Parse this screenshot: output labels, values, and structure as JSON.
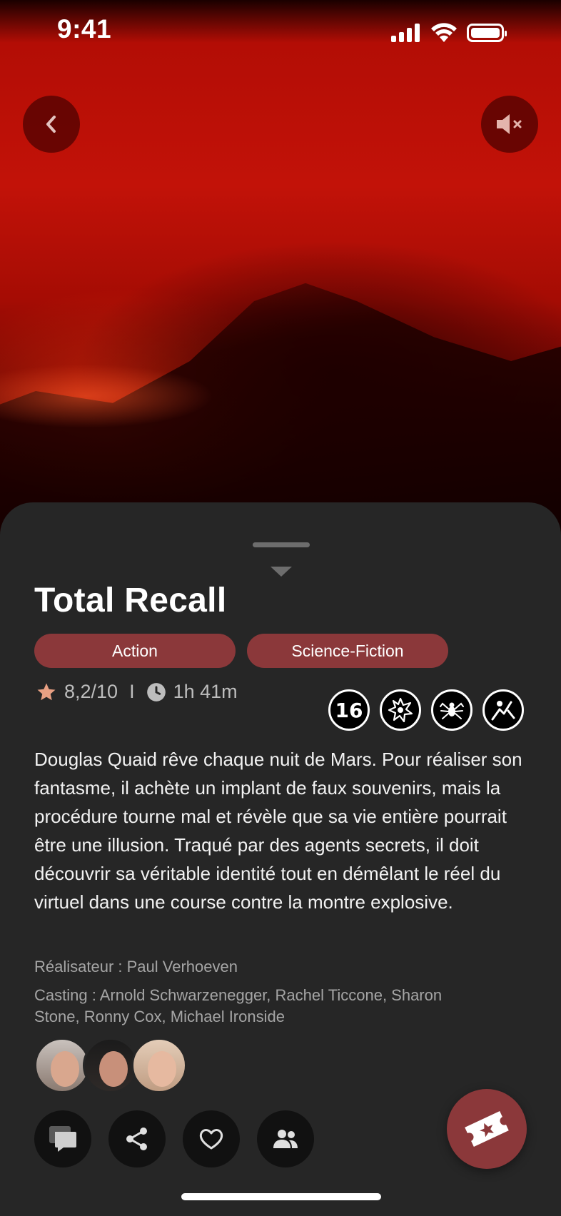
{
  "status_bar": {
    "time": "9:41"
  },
  "movie": {
    "title": "Total Recall",
    "genres": [
      "Action",
      "Science-Fiction"
    ],
    "rating": "8,2/10",
    "separator": "I",
    "duration": "1h 41m",
    "age_rating": "16",
    "content_warnings": [
      "violence-icon",
      "spider-fear-icon",
      "frightening-scenes-icon"
    ],
    "synopsis": "Douglas Quaid rêve chaque nuit de Mars. Pour réaliser son fantasme, il achète un implant de faux souvenirs, mais la procédure tourne mal et révèle que sa vie entière pourrait être une illusion. Traqué par des agents secrets, il doit découvrir sa véritable identité tout en démêlant le réel du virtuel dans une course contre la montre explosive.",
    "director_line": "Réalisateur : Paul Verhoeven",
    "cast_line": "Casting : Arnold Schwarzenegger, Rachel Ticcone, Sharon Stone, Ronny Cox, Michael Ironside"
  },
  "colors": {
    "accent": "#8b383a",
    "sheet_background": "#262626",
    "star": "#e8a083"
  },
  "actions": [
    "comments-icon",
    "share-icon",
    "heart-icon",
    "group-icon"
  ],
  "primary_action": "ticket-icon"
}
